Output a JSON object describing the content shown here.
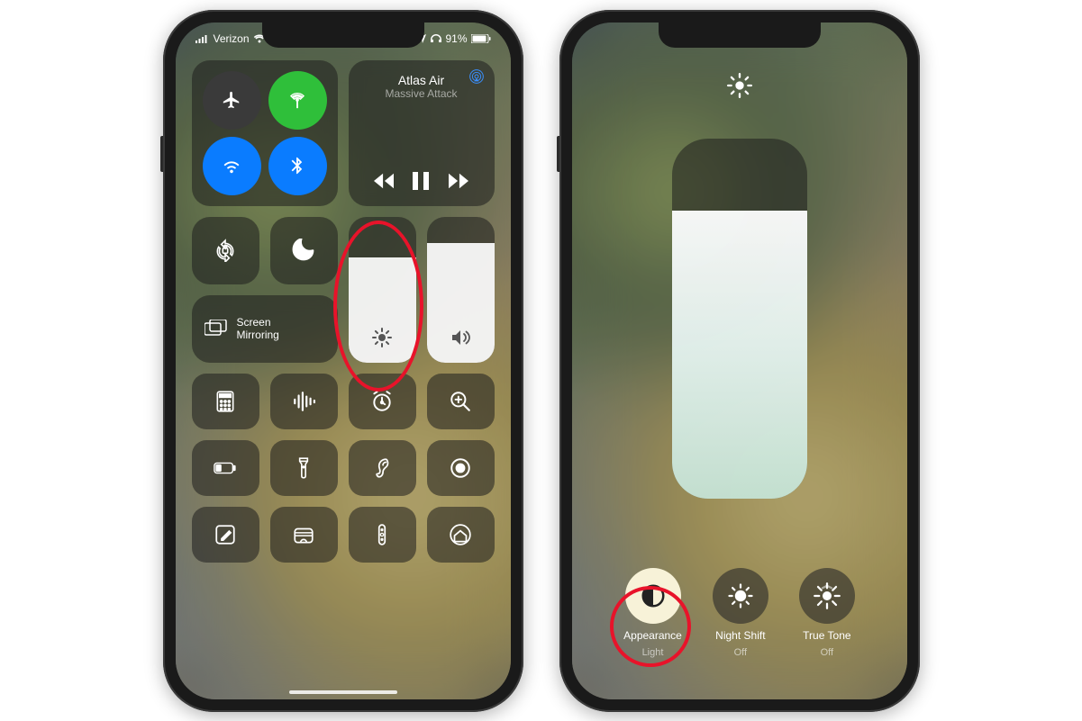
{
  "statusBar": {
    "carrier": "Verizon",
    "batteryPercent": "91%"
  },
  "connectivity": {
    "airplane": {
      "active": false,
      "bg": "#3a3a3a"
    },
    "cellular": {
      "active": true,
      "bg": "#2fbf3a"
    },
    "wifi": {
      "active": true,
      "bg": "#0a7cff"
    },
    "bluetooth": {
      "active": true,
      "bg": "#0a7cff"
    }
  },
  "music": {
    "title": "Atlas Air",
    "artist": "Massive Attack"
  },
  "screenMirroring": {
    "label": "Screen\nMirroring"
  },
  "brightness": {
    "percent": 72
  },
  "volume": {
    "percent": 82
  },
  "bigBrightness": {
    "percent": 80
  },
  "options": {
    "appearance": {
      "label": "Appearance",
      "value": "Light",
      "activeBg": "#f7f2d8"
    },
    "nightShift": {
      "label": "Night Shift",
      "value": "Off"
    },
    "trueTone": {
      "label": "True Tone",
      "value": "Off"
    }
  },
  "tiles": [
    "calculator",
    "voice-memos",
    "alarm",
    "magnifier",
    "low-power",
    "flashlight",
    "hearing",
    "screen-record",
    "notes",
    "wallet",
    "remote",
    "home"
  ]
}
